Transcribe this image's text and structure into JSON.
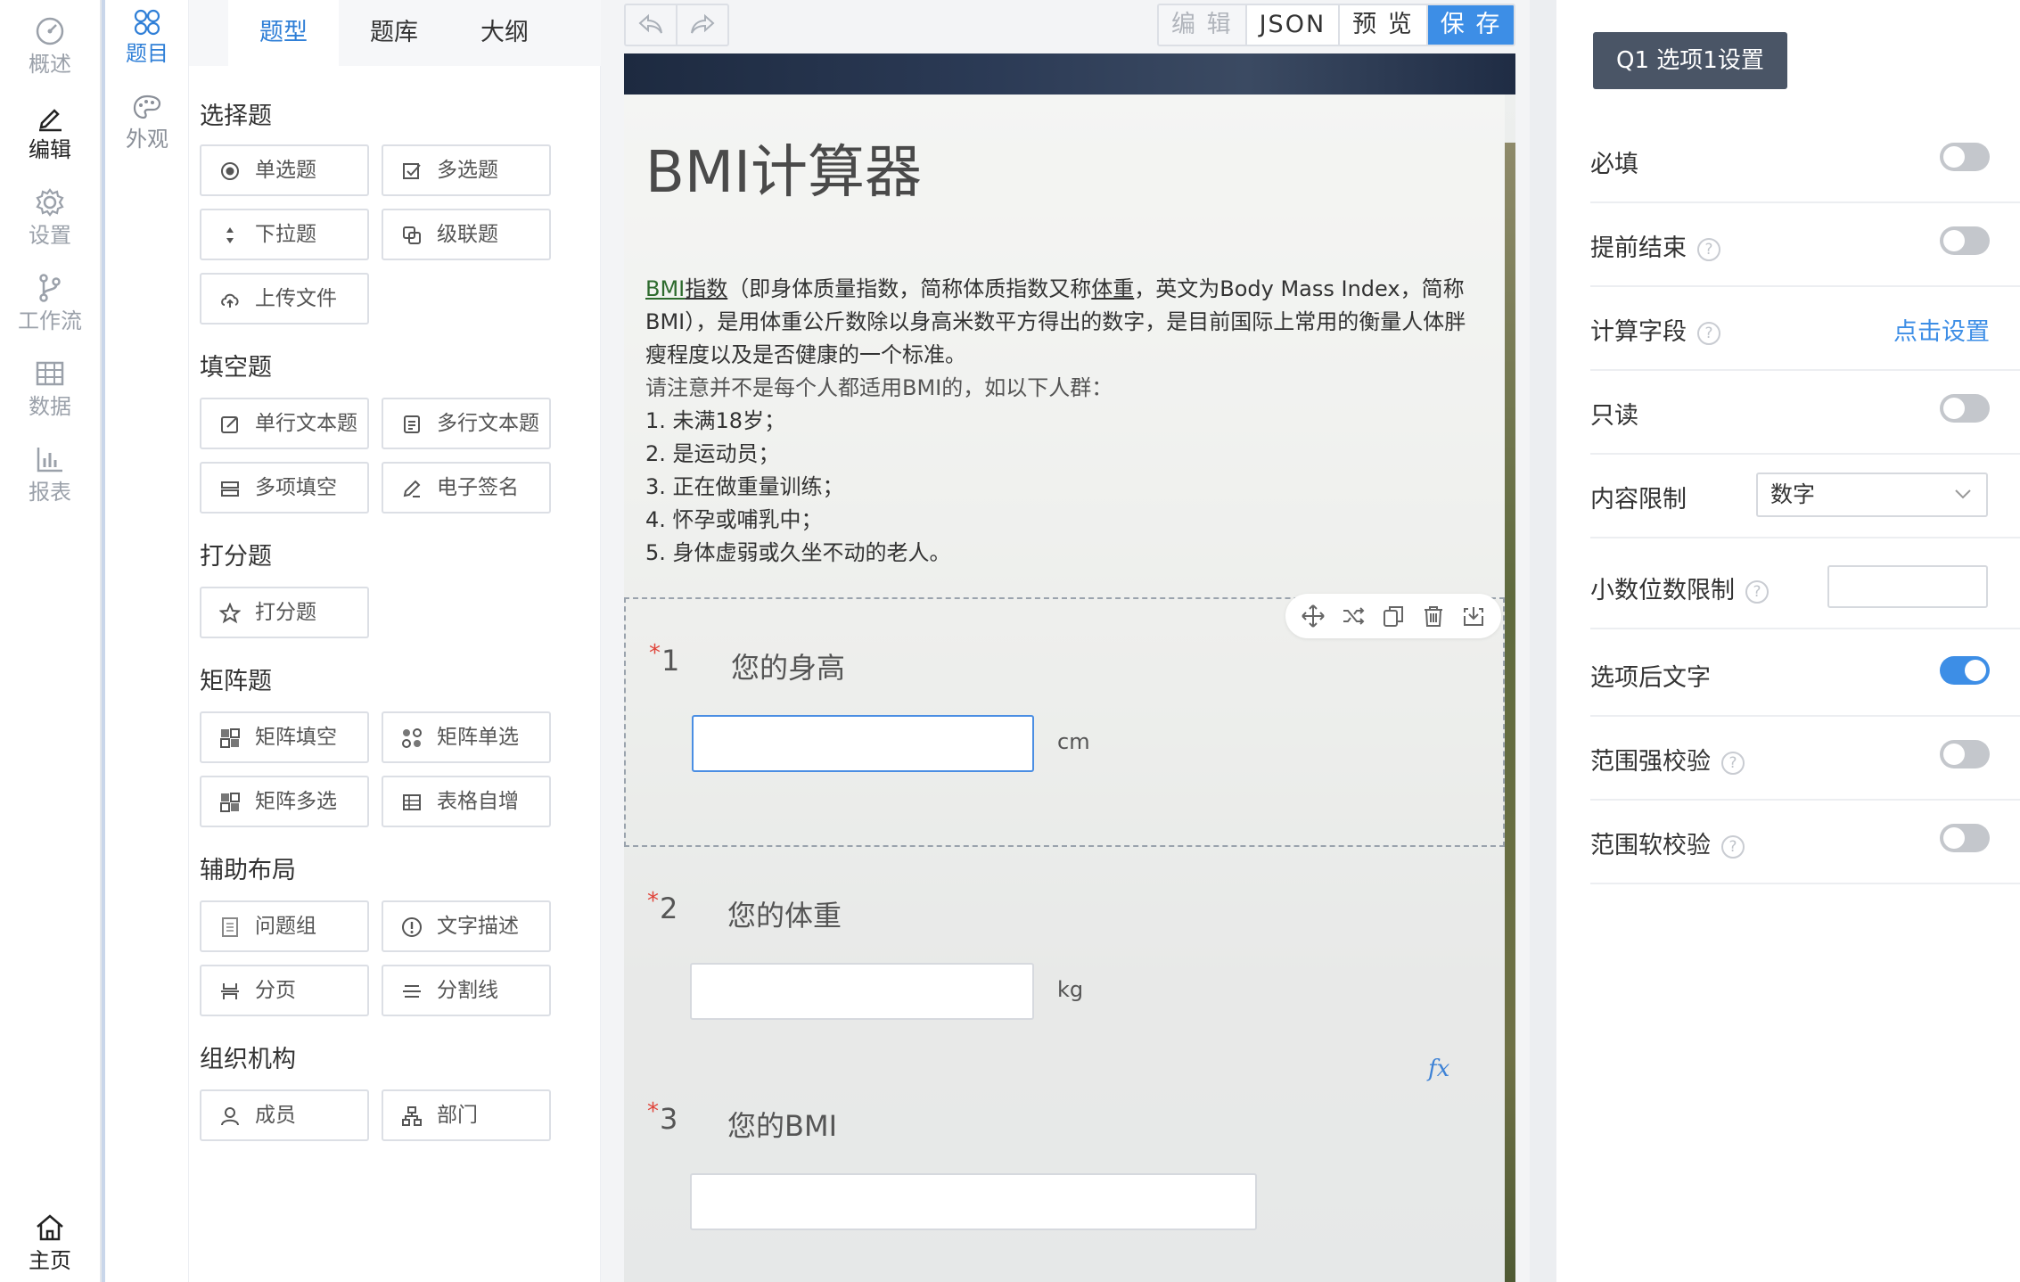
{
  "nav": {
    "items": [
      {
        "label": "概述",
        "icon": "gauge-icon"
      },
      {
        "label": "编辑",
        "icon": "pencil-icon"
      },
      {
        "label": "设置",
        "icon": "gear-icon"
      },
      {
        "label": "工作流",
        "icon": "branch-icon"
      },
      {
        "label": "数据",
        "icon": "grid-icon"
      },
      {
        "label": "报表",
        "icon": "bar-chart-icon"
      }
    ],
    "home": {
      "label": "主页",
      "icon": "home-icon"
    }
  },
  "subnav": {
    "items": [
      {
        "label": "题目",
        "icon": "flower-icon"
      },
      {
        "label": "外观",
        "icon": "palette-icon"
      }
    ]
  },
  "qpanel": {
    "tabs": [
      "题型",
      "题库",
      "大纲"
    ],
    "sections": [
      {
        "title": "选择题",
        "buttons": [
          "单选题",
          "多选题",
          "下拉题",
          "级联题",
          "上传文件"
        ]
      },
      {
        "title": "填空题",
        "buttons": [
          "单行文本题",
          "多行文本题",
          "多项填空",
          "电子签名"
        ]
      },
      {
        "title": "打分题",
        "buttons": [
          "打分题"
        ]
      },
      {
        "title": "矩阵题",
        "buttons": [
          "矩阵填空",
          "矩阵单选",
          "矩阵多选",
          "表格自增"
        ]
      },
      {
        "title": "辅助布局",
        "buttons": [
          "问题组",
          "文字描述",
          "分页",
          "分割线"
        ]
      },
      {
        "title": "组织机构",
        "buttons": [
          "成员",
          "部门"
        ]
      }
    ]
  },
  "toolbar": {
    "modes": [
      "编 辑",
      "JSON",
      "预 览",
      "保 存"
    ]
  },
  "form": {
    "title": "BMI计算器",
    "desc": {
      "part1": "BMI",
      "part2": "指数",
      "part3": "（即身体质量指数，简称体质指数又称",
      "part4": "体重",
      "part5": "，英文为Body Mass Index，简称BMI），是用体重公斤数除以身高米数平方得出的数字，是目前国际上常用的衡量人体胖瘦程度以及是否健康的一个标准。",
      "note": "请注意并不是每个人都适用BMI的，如以下人群：",
      "list": [
        "1. 未满18岁；",
        "2. 是运动员；",
        "3. 正在做重量训练；",
        "4. 怀孕或哺乳中；",
        "5. 身体虚弱或久坐不动的老人。"
      ]
    },
    "questions": [
      {
        "num": "1",
        "title": "您的身高",
        "unit": "cm",
        "required": "*"
      },
      {
        "num": "2",
        "title": "您的体重",
        "unit": "kg",
        "required": "*"
      },
      {
        "num": "3",
        "title": "您的BMI",
        "unit": "",
        "required": "*"
      }
    ],
    "fx": "fx"
  },
  "settings": {
    "header": "Q1 选项1设置",
    "rows": [
      {
        "label": "必填",
        "control": "toggle",
        "on": false
      },
      {
        "label": "提前结束",
        "control": "toggle",
        "on": false,
        "help": "?"
      },
      {
        "label": "计算字段",
        "control": "link",
        "link": "点击设置",
        "help": "?"
      },
      {
        "label": "只读",
        "control": "toggle",
        "on": false
      },
      {
        "label": "内容限制",
        "control": "select",
        "value": "数字"
      },
      {
        "label": "小数位数限制",
        "control": "number",
        "help": "?"
      },
      {
        "label": "选项后文字",
        "control": "toggle",
        "on": true
      },
      {
        "label": "范围强校验",
        "control": "toggle",
        "on": false,
        "help": "?"
      },
      {
        "label": "范围软校验",
        "control": "toggle",
        "on": false,
        "help": "?"
      }
    ],
    "accent": "#3d8ee6"
  }
}
